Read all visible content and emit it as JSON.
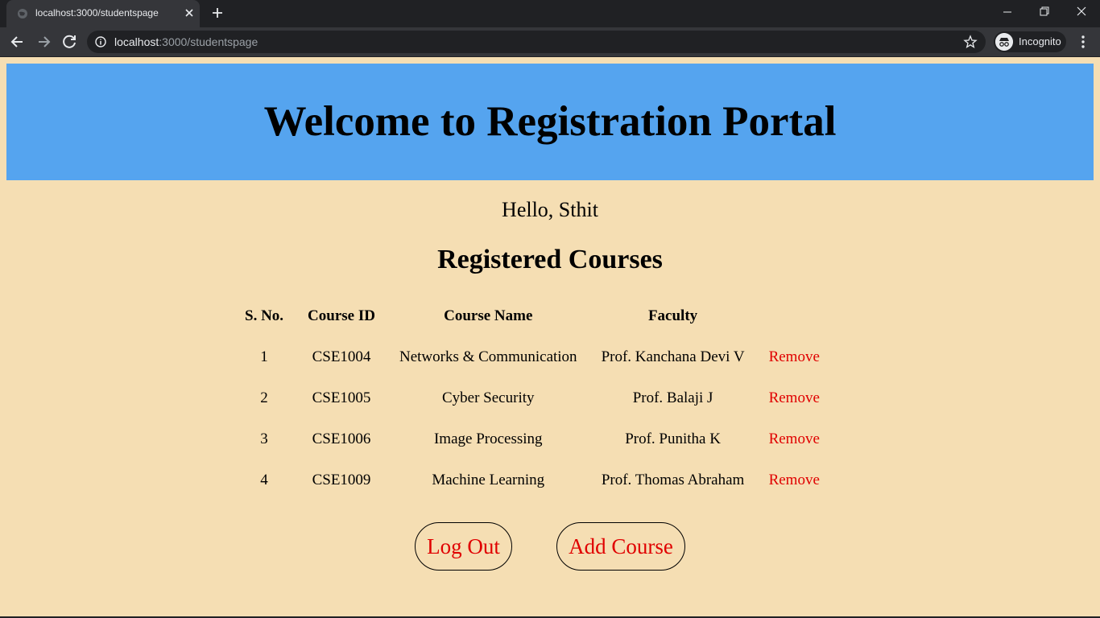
{
  "browser": {
    "tab_title": "localhost:3000/studentspage",
    "url_host": "localhost",
    "url_path": ":3000/studentspage",
    "profile_label": "Incognito",
    "icons": [
      "globe-icon",
      "close-icon",
      "plus-icon",
      "minimize-icon",
      "restore-icon",
      "window-close-icon",
      "back-arrow-icon",
      "forward-arrow-icon",
      "reload-icon",
      "info-icon",
      "star-icon",
      "incognito-icon",
      "kebab-menu-icon"
    ]
  },
  "page": {
    "banner_title": "Welcome to Registration Portal",
    "greeting": "Hello, Sthit",
    "section_title": "Registered Courses",
    "table": {
      "headers": [
        "S. No.",
        "Course ID",
        "Course Name",
        "Faculty",
        ""
      ],
      "rows": [
        {
          "sno": "1",
          "course_id": "CSE1004",
          "course_name": "Networks & Communication",
          "faculty": "Prof. Kanchana Devi V",
          "action": "Remove"
        },
        {
          "sno": "2",
          "course_id": "CSE1005",
          "course_name": "Cyber Security",
          "faculty": "Prof. Balaji J",
          "action": "Remove"
        },
        {
          "sno": "3",
          "course_id": "CSE1006",
          "course_name": "Image Processing",
          "faculty": "Prof. Punitha K",
          "action": "Remove"
        },
        {
          "sno": "4",
          "course_id": "CSE1009",
          "course_name": "Machine Learning",
          "faculty": "Prof. Thomas Abraham",
          "action": "Remove"
        }
      ]
    },
    "buttons": {
      "logout": "Log Out",
      "add_course": "Add Course"
    }
  },
  "colors": {
    "page_background": "#f5deb3",
    "banner_background": "#55a4ef",
    "action_text": "#e00000",
    "chrome_dark": "#202124",
    "chrome_toolbar": "#35363a"
  }
}
